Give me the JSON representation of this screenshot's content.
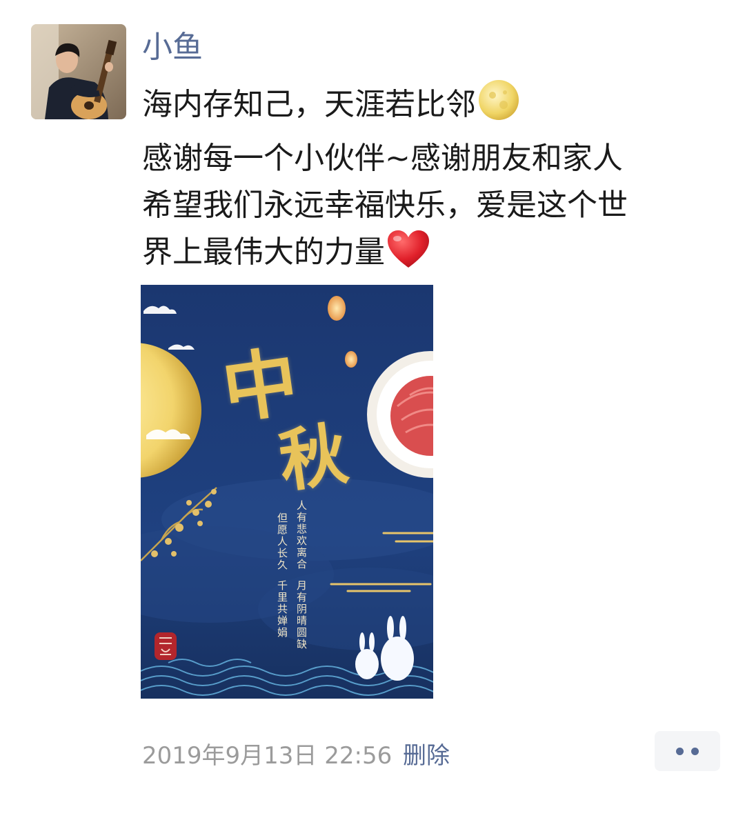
{
  "post": {
    "author": "小鱼",
    "text_lines": [
      "海内存知己，天涯若比邻",
      "感谢每一个小伙伴~感谢朋友和家人",
      "希望我们永远幸福快乐，爱是这个世",
      "界上最伟大的力量"
    ],
    "emojis": [
      "full-moon-emoji",
      "red-heart-emoji"
    ],
    "timestamp": "2019年9月13日 22:56",
    "delete_label": "删除",
    "more_icon": "ellipsis-icon"
  },
  "poster": {
    "title_chars": [
      "中",
      "秋"
    ],
    "poem_columns": [
      "人有悲欢离合",
      "但愿人长久",
      "月有阴晴圆缺",
      "千里共婵娟"
    ],
    "colors": {
      "background": "#1d3a72",
      "moon": "#f4dc7c",
      "gold": "#e8c35a"
    }
  },
  "colors": {
    "link": "#576b95",
    "text": "#1a1a1a",
    "muted": "#9b9b9b"
  }
}
